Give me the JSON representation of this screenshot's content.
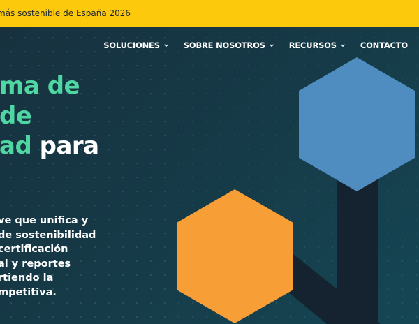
{
  "announcement": {
    "text": "más sostenible de España 2026"
  },
  "nav": {
    "items": [
      {
        "label": "SOLUCIONES",
        "has_dropdown": true
      },
      {
        "label": "SOBRE NOSOTROS",
        "has_dropdown": true
      },
      {
        "label": "RECURSOS",
        "has_dropdown": true
      },
      {
        "label": "CONTACTO",
        "has_dropdown": false
      }
    ]
  },
  "hero": {
    "title_lines": [
      "ma de",
      "de",
      "ad",
      "para"
    ],
    "description_lines": [
      "ve que unifica y",
      "de sostenibilidad",
      "certificación",
      "al y reportes",
      "rtiendo la",
      "mpetitiva."
    ]
  },
  "colors": {
    "announce_bg": "#fdc90c",
    "background": "#163b48",
    "accent_green": "#4fd6a3",
    "hex_blue": "#4f8cc0",
    "hex_orange": "#f89e36",
    "connector": "#14232f"
  },
  "icons": {
    "dropdown": "chevron-down-icon"
  }
}
